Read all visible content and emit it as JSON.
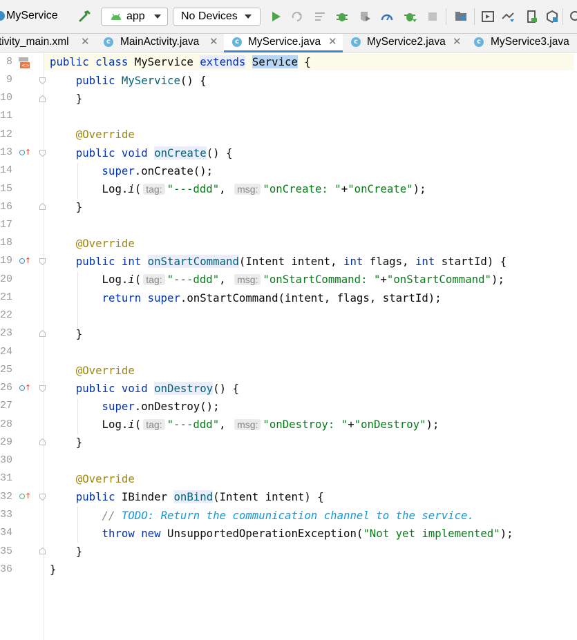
{
  "toolbar": {
    "project_name": "MyService",
    "run_config": "app",
    "device": "No Devices",
    "icons": [
      "hammer-icon",
      "run-icon",
      "apply-changes-icon",
      "apply-code-changes-icon",
      "debug-icon",
      "coverage-icon",
      "profile-icon",
      "attach-debugger-icon",
      "stop-icon",
      "project-structure-icon",
      "avd-manager-icon",
      "sdk-manager-icon",
      "device-manager-icon",
      "layout-inspector-icon",
      "search-icon"
    ]
  },
  "tabs": [
    {
      "label": "tivity_main.xml",
      "active": false,
      "icon": "xml-icon"
    },
    {
      "label": "MainActivity.java",
      "active": false,
      "icon": "class-icon"
    },
    {
      "label": "MyService.java",
      "active": true,
      "icon": "class-icon"
    },
    {
      "label": "MyService2.java",
      "active": false,
      "icon": "class-icon"
    },
    {
      "label": "MyService3.java",
      "active": false,
      "icon": "class-icon"
    }
  ],
  "editor": {
    "line_numbers": [
      "8",
      "9",
      "10",
      "11",
      "12",
      "13",
      "14",
      "15",
      "16",
      "17",
      "18",
      "19",
      "20",
      "21",
      "22",
      "23",
      "24",
      "25",
      "26",
      "27",
      "28",
      "29",
      "30",
      "31",
      "32",
      "33",
      "34",
      "35",
      "36"
    ],
    "code": {
      "l8": {
        "a": "public class ",
        "b": "MyService ",
        "c": "extends",
        "d": " ",
        "e": "Service",
        "f": " {"
      },
      "l9": {
        "a": "    public ",
        "b": "MyService",
        "c": "() {"
      },
      "l10": "    }",
      "l12": "    @Override",
      "l13": {
        "a": "    public void ",
        "b": "onCreate",
        "c": "() {"
      },
      "l14": {
        "a": "        super",
        "b": ".onCreate();"
      },
      "l15": {
        "a": "        Log.",
        "b": "i",
        "c": "(",
        "hint1": "tag:",
        "s1": "\"---ddd\"",
        "comma": ", ",
        "hint2": "msg:",
        "s2": "\"onCreate: \"",
        "plus": "+",
        "s3": "\"onCreate\"",
        "end": ");"
      },
      "l16": "    }",
      "l18": "    @Override",
      "l19": {
        "a": "    public int ",
        "b": "onStartCommand",
        "c": "(Intent intent, ",
        "d": "int",
        "e": " flags, ",
        "f": "int",
        "g": " startId) {"
      },
      "l20": {
        "a": "        Log.",
        "b": "i",
        "c": "(",
        "hint1": "tag:",
        "s1": "\"---ddd\"",
        "comma": ", ",
        "hint2": "msg:",
        "s2": "\"onStartCommand: \"",
        "plus": "+",
        "s3": "\"onStartCommand\"",
        "end": ");"
      },
      "l21": {
        "a": "        return ",
        "b": "super",
        "c": ".onStartCommand(intent, flags, startId);"
      },
      "l23": "    }",
      "l25": "    @Override",
      "l26": {
        "a": "    public void ",
        "b": "onDestroy",
        "c": "() {"
      },
      "l27": {
        "a": "        super",
        "b": ".onDestroy();"
      },
      "l28": {
        "a": "        Log.",
        "b": "i",
        "c": "(",
        "hint1": "tag:",
        "s1": "\"---ddd\"",
        "comma": ", ",
        "hint2": "msg:",
        "s2": "\"onDestroy: \"",
        "plus": "+",
        "s3": "\"onDestroy\"",
        "end": ");"
      },
      "l29": "    }",
      "l31": "    @Override",
      "l32": {
        "a": "    public ",
        "b": "IBinder ",
        "c": "onBind",
        "d": "(Intent intent) {"
      },
      "l33": {
        "a": "        // ",
        "b": "TODO: Return the communication channel to the service."
      },
      "l34": {
        "a": "        throw new ",
        "b": "UnsupportedOperationException(",
        "c": "\"Not yet implemented\"",
        "d": ");"
      },
      "l35": "    }",
      "l36": "}"
    }
  },
  "colors": {
    "keyword": "#0033b3",
    "annotation": "#9e880d",
    "string": "#067d17",
    "comment": "#0d9ad6",
    "active_tab_underline": "#4083c9"
  }
}
